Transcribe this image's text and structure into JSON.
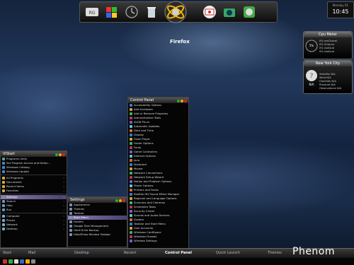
{
  "dock": {
    "items": [
      {
        "name": "network-dock-icon"
      },
      {
        "name": "windows-dock-icon"
      },
      {
        "name": "clock-dock-icon"
      },
      {
        "name": "recycle-bin-dock-icon"
      },
      {
        "name": "firefox-dock-icon"
      },
      {
        "name": "mail-dock-icon"
      },
      {
        "name": "camera-dock-icon"
      },
      {
        "name": "disk-dock-icon"
      }
    ],
    "active_label": "Firefox"
  },
  "cpu_gadget": {
    "title": "Cpu Meter",
    "percent": "5%",
    "lines": [
      "0% meChanel",
      "0% X-Hours",
      "0% ivo4sub",
      "0% ivo4sub"
    ]
  },
  "weather_gadget": {
    "title": "New York City",
    "temp": "N/A",
    "lines": [
      "Visibility N/A",
      "Wind N/A",
      "Humidity N/A",
      "Pressure N/A",
      "Observations N/A"
    ]
  },
  "control_panel": {
    "title": "Control Panel",
    "items": [
      "Accessibility Options",
      "Add Hardware",
      "Add or Remove Programs",
      "Administrative Tools",
      "AVG8 Phun!",
      "Automatic Updates",
      "Date and Time",
      "Display",
      "Flash Player",
      "Folder Options",
      "Fonts",
      "Game Controllers",
      "Internet Options",
      "Java",
      "Keyboard",
      "Mouse",
      "Network Connections",
      "Network Setup Wizard",
      "Notion and Problem Options",
      "Power Options",
      "Printers and Faxes",
      "Realtek HD Sound Effect Manager",
      "Regional and Language Options",
      "Scanners and Cameras",
      "Scheduled Tasks",
      "Security Center",
      "Sounds and Audio Devices",
      "System",
      "Taskbar and Start Menu",
      "User Accounts",
      "Windows CardSpace",
      "Windows Firewall",
      "Wireless Settings"
    ]
  },
  "start_menu": {
    "title": "ViStart",
    "top_items": [
      "Programs Unity",
      "Set Program Access and Defau...",
      "Windows Catalog",
      "Windows Update"
    ],
    "mid_items": [
      "All Programs",
      "Documents",
      "Recent Items",
      "Favorites"
    ],
    "selected": "Settings",
    "lower_items": [
      "Search",
      "Help",
      "Run"
    ],
    "bottom_items": [
      "Computer",
      "Places",
      "Network",
      "Desktop"
    ]
  },
  "settings_menu": {
    "title": "Settings",
    "items": [
      "Appearance",
      "Themes",
      "Taskbar",
      "Start Menu",
      "Folders",
      "Google Task Management",
      "Hard Drive Backup",
      "Hide/Show Window Taskbar"
    ],
    "selected_index": 3
  },
  "taskbar": {
    "items": [
      "Start",
      "Mail",
      "Desktop",
      "Recent",
      "Control Panel",
      "Quick Launch",
      "Themes"
    ],
    "active": "Control Panel"
  },
  "clock": {
    "date": "Monday 01",
    "time": "10:45"
  },
  "brand": "Phenom",
  "colors": {
    "menu_highlight": "#8a7bb0",
    "panel": "#050505"
  }
}
